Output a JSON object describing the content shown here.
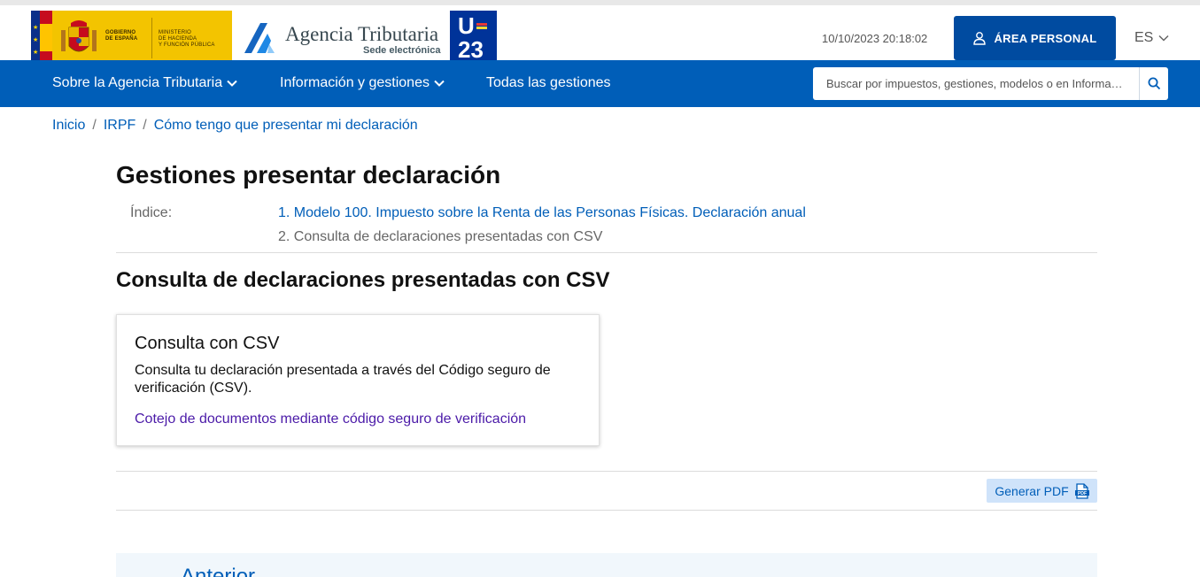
{
  "header": {
    "gov_line1": "GOBIERNO",
    "gov_line2": "DE ESPAÑA",
    "ministry_line1": "MINISTERIO",
    "ministry_line2": "DE HACIENDA",
    "ministry_line3": "Y FUNCIÓN PÚBLICA",
    "agency_name": "Agencia Tributaria",
    "agency_sub": "Sede electrónica",
    "ue_line1": "U",
    "ue_line2": "23",
    "datetime": "10/10/2023 20:18:02",
    "area_personal_label": "ÁREA PERSONAL",
    "language": "ES"
  },
  "nav": {
    "items": [
      {
        "label": "Sobre la Agencia Tributaria",
        "has_dropdown": true
      },
      {
        "label": "Información y gestiones",
        "has_dropdown": true
      },
      {
        "label": "Todas las gestiones",
        "has_dropdown": false
      }
    ],
    "search_placeholder": "Buscar por impuestos, gestiones, modelos o en Informa…"
  },
  "breadcrumb": {
    "items": [
      "Inicio",
      "IRPF",
      "Cómo tengo que presentar mi declaración"
    ],
    "separator": "/"
  },
  "main": {
    "title": "Gestiones presentar declaración",
    "index_label": "Índice:",
    "index_items": [
      {
        "label": "1. Modelo 100. Impuesto sobre la Renta de las Personas Físicas. Declaración anual",
        "is_link": true
      },
      {
        "label": "2. Consulta de declaraciones presentadas con CSV",
        "is_link": false
      }
    ],
    "section_title": "Consulta de declaraciones presentadas con CSV",
    "card": {
      "title": "Consulta con CSV",
      "description": "Consulta tu declaración presentada a través del Código seguro de verificación (CSV).",
      "link": "Cotejo de documentos mediante código seguro de verificación"
    },
    "pdf_button_label": "Generar PDF",
    "prev_label": "Anterior"
  },
  "colors": {
    "nav_blue": "#005eb8",
    "button_blue": "#004ba0",
    "gov_yellow": "#f3c400",
    "eu_blue": "#003399",
    "visited_link": "#4b1aa8"
  }
}
